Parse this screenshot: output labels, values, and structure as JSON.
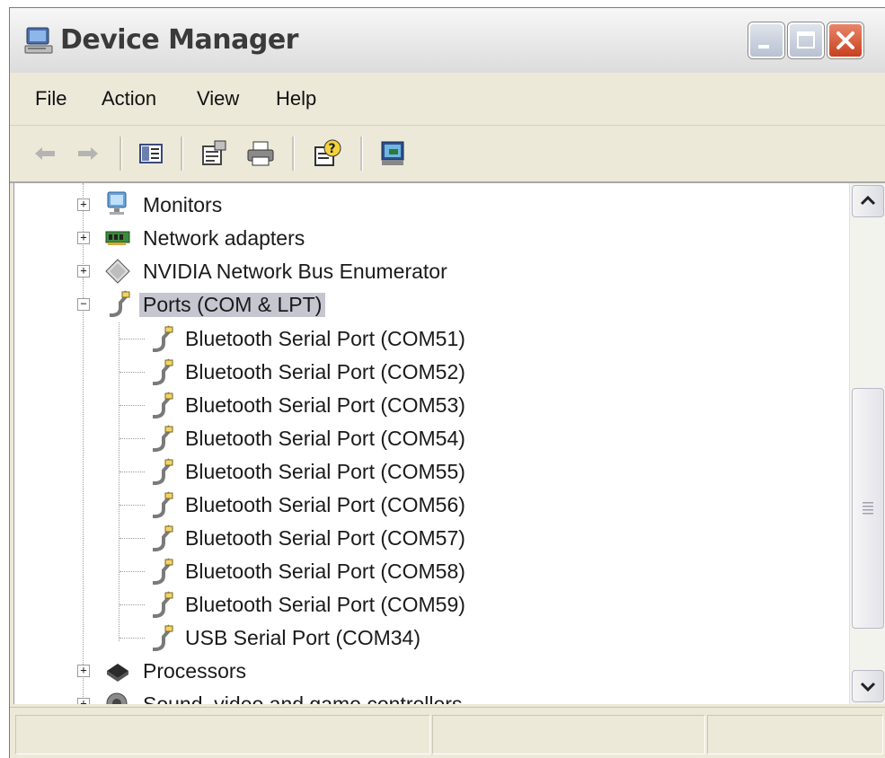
{
  "window": {
    "title": "Device Manager",
    "controls": [
      "minimize-icon",
      "maximize-icon",
      "close-icon"
    ]
  },
  "menu": [
    "File",
    "Action",
    "View",
    "Help"
  ],
  "toolbar": {
    "buttons": [
      "back-arrow-icon",
      "forward-arrow-icon",
      "show-hide-tree-icon",
      "properties-icon",
      "print-icon",
      "help-icon",
      "scan-hardware-icon"
    ]
  },
  "tree": {
    "categories_top": [
      {
        "label": "Monitors",
        "expander": "+",
        "icon": "monitor-icon"
      },
      {
        "label": "Network adapters",
        "expander": "+",
        "icon": "network-card-icon"
      },
      {
        "label": "NVIDIA Network Bus Enumerator",
        "expander": "+",
        "icon": "bus-enumerator-icon"
      }
    ],
    "ports": {
      "label": "Ports (COM & LPT)",
      "expander": "−",
      "icon": "port-connector-icon",
      "selected": true,
      "children": [
        "Bluetooth Serial Port (COM51)",
        "Bluetooth Serial Port (COM52)",
        "Bluetooth Serial Port (COM53)",
        "Bluetooth Serial Port (COM54)",
        "Bluetooth Serial Port (COM55)",
        "Bluetooth Serial Port (COM56)",
        "Bluetooth Serial Port (COM57)",
        "Bluetooth Serial Port (COM58)",
        "Bluetooth Serial Port (COM59)",
        "USB Serial Port (COM34)"
      ]
    },
    "categories_bottom": [
      {
        "label": "Processors",
        "expander": "+",
        "icon": "processor-icon"
      },
      {
        "label": "Sound, video and game controllers",
        "expander": "+",
        "icon": "speaker-icon"
      }
    ]
  },
  "colors": {
    "selection": "#c6c6d0",
    "close_button": "#d9542f",
    "window_face": "#ece9d8"
  }
}
